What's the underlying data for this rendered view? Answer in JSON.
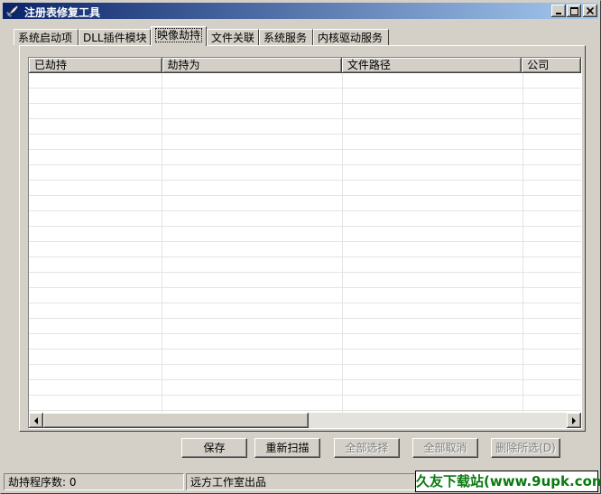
{
  "window": {
    "title": "注册表修复工具"
  },
  "tabs": [
    {
      "label": "系统启动项"
    },
    {
      "label": "DLL插件模块"
    },
    {
      "label": "映像劫持",
      "active": true
    },
    {
      "label": "文件关联"
    },
    {
      "label": "系统服务"
    },
    {
      "label": "内核驱动服务"
    }
  ],
  "list": {
    "columns": [
      "已劫持",
      "劫持为",
      "文件路径",
      "公司"
    ],
    "rows": []
  },
  "buttons": {
    "save": "保存",
    "rescan": "重新扫描",
    "select_all": "全部选择",
    "deselect_all": "全部取消",
    "delete_selected": "删除所选(D)"
  },
  "status": {
    "count_label": "劫持程序数:",
    "count": "0",
    "producer": "远方工作室出品"
  },
  "watermark": "久友下载站(www.9upk.com)",
  "colors": {
    "titlebar_start": "#0a246a",
    "titlebar_end": "#a6caf0",
    "watermark_text": "#0a7a10"
  }
}
